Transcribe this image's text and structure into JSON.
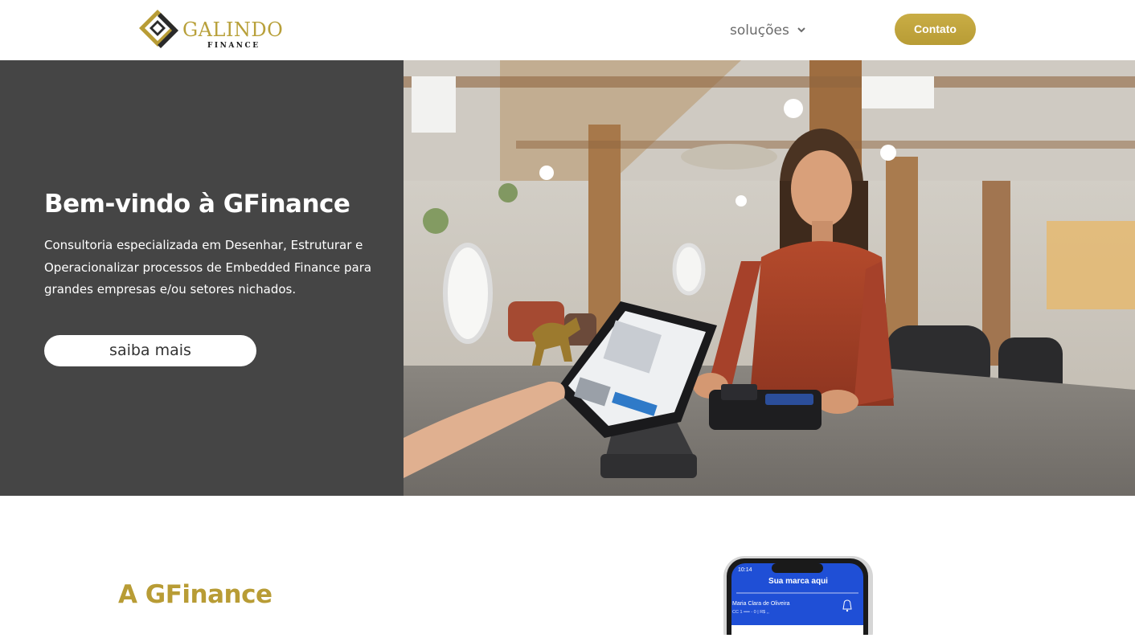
{
  "header": {
    "logo": {
      "wordmark": "GALINDO",
      "subtitle": "FINANCE",
      "icon": "diamond-logo-icon"
    },
    "nav": {
      "solucoes_label": "soluções",
      "solucoes_icon": "chevron-down-icon"
    },
    "contato_label": "Contato"
  },
  "hero": {
    "title": "Bem-vindo à GFinance",
    "description": "Consultoria especializada em Desenhar, Estruturar e Operacionalizar processos de Embedded Finance para grandes empresas e/ou setores nichados.",
    "cta_label": "saiba mais",
    "image": "photo of a woman at a shop counter with a payment terminal and tablet POS"
  },
  "about": {
    "title": "A GFinance"
  },
  "phone_mockup": {
    "time": "10:14",
    "app_title": "Sua marca aqui",
    "user_name": "Maria Clara de Oliveira",
    "account_line": "CC 1 •••• - 0 | R$ ,,",
    "bell_icon": "bell-icon"
  },
  "colors": {
    "gold": "#b89c35",
    "hero_panel": "#454545",
    "app_blue": "#1f4fd6"
  }
}
